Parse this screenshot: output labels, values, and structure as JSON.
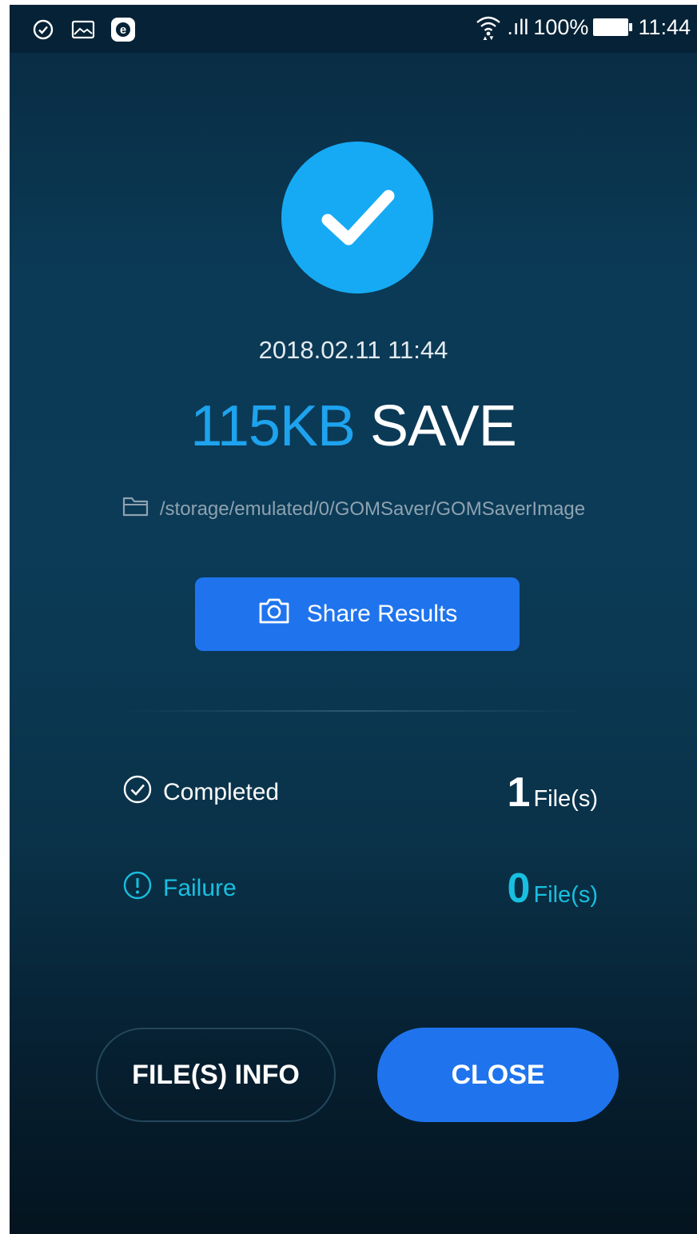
{
  "status_bar": {
    "left_icons": [
      "check-circle-icon",
      "image-icon",
      "e-badge-icon"
    ],
    "signal_text": ".ıll",
    "battery_text": "100%",
    "time": "11:44"
  },
  "result": {
    "icon": "check-icon",
    "datetime": "2018.02.11 11:44",
    "size": "115KB",
    "action_word": "SAVE",
    "path_icon": "folder-icon",
    "path": "/storage/emulated/0/GOMSaver/GOMSaverImage"
  },
  "share_button": {
    "icon": "camera-icon",
    "label": "Share Results"
  },
  "stats": {
    "completed": {
      "label": "Completed",
      "count": "1",
      "unit": "File(s)"
    },
    "failure": {
      "label": "Failure",
      "count": "0",
      "unit": "File(s)"
    }
  },
  "buttons": {
    "info_label": "FILE(S) INFO",
    "close_label": "CLOSE"
  },
  "colors": {
    "accent_blue": "#1f74ee",
    "check_circle": "#16aaf4",
    "size_text": "#1ea3ee",
    "failure_text": "#19bfe0",
    "background_top": "#082a40",
    "background_bottom": "#04141f"
  }
}
